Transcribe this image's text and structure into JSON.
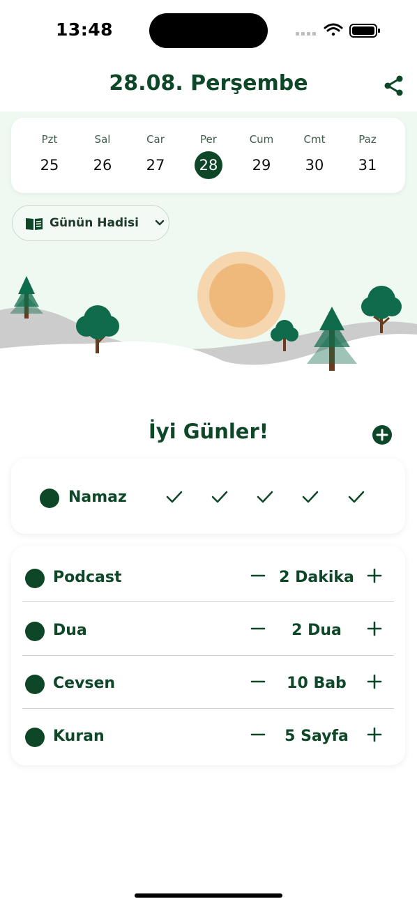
{
  "status_bar": {
    "time": "13:48"
  },
  "header": {
    "title": "28.08. Perşembe"
  },
  "week": {
    "days": [
      {
        "name": "Pzt",
        "num": "25"
      },
      {
        "name": "Sal",
        "num": "26"
      },
      {
        "name": "Car",
        "num": "27"
      },
      {
        "name": "Per",
        "num": "28"
      },
      {
        "name": "Cum",
        "num": "29"
      },
      {
        "name": "Cmt",
        "num": "30"
      },
      {
        "name": "Paz",
        "num": "31"
      }
    ],
    "selected_index": 3
  },
  "hadis_button": {
    "label": "Günün Hadisi"
  },
  "greeting": "İyi Günler!",
  "namaz": {
    "label": "Namaz",
    "checks_completed": 5
  },
  "tasks": [
    {
      "label": "Podcast",
      "value": "2 Dakika"
    },
    {
      "label": "Dua",
      "value": "2 Dua"
    },
    {
      "label": "Cevsen",
      "value": "10 Bab"
    },
    {
      "label": "Kuran",
      "value": "5 Sayfa"
    }
  ],
  "colors": {
    "primary": "#0e4727",
    "hero_background": "#eefaf1",
    "sun": "#f0b979",
    "hill": "#cfcfcf"
  },
  "icons": {
    "share": "share-icon",
    "book": "book-icon",
    "chevron": "chevron-down-icon",
    "add": "plus-circle-icon",
    "check": "check-icon",
    "minus": "minus-icon",
    "plus": "plus-icon"
  }
}
